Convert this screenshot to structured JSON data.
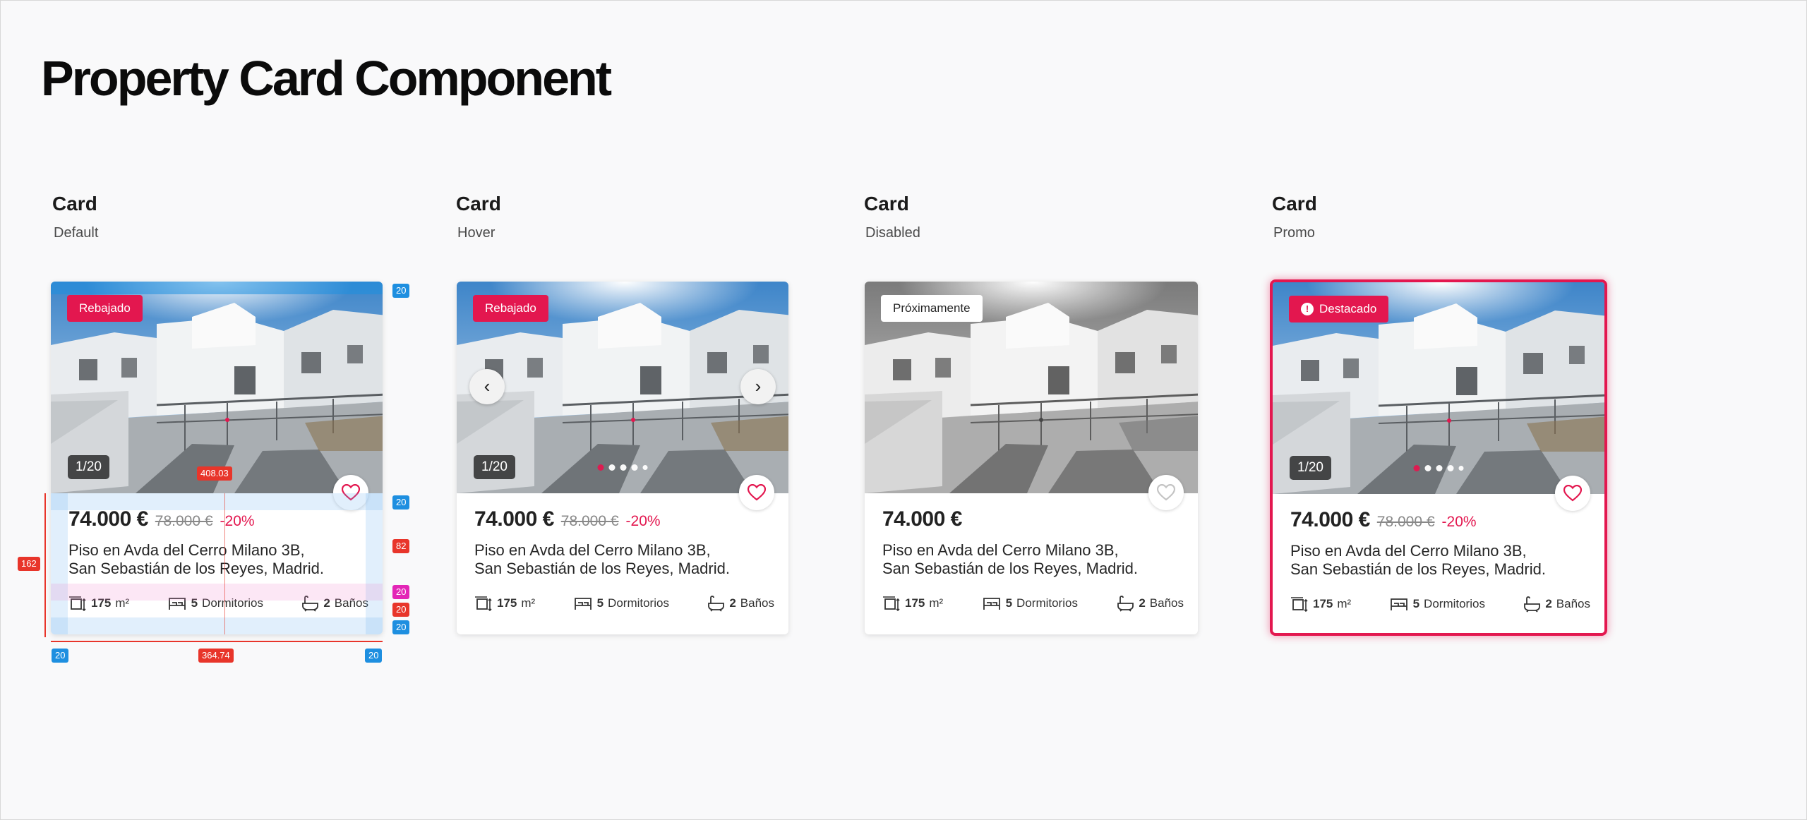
{
  "page": {
    "title": "Property Card Component"
  },
  "colors": {
    "accent": "#e3174f",
    "spec_blue": "#1e8fe0",
    "spec_red": "#e8352a",
    "spec_magenta": "#e326b6"
  },
  "shared": {
    "price": "74.000 €",
    "old_price": "78.000 €",
    "discount": "-20%",
    "address_line1": "Piso en Avda del Cerro Milano 3B,",
    "address_line2": "San Sebastián de los Reyes, Madrid.",
    "area_value": "175",
    "area_unit": "m²",
    "rooms_value": "5",
    "rooms_label": "Dormitorios",
    "baths_value": "2",
    "baths_label": "Baños",
    "counter": "1/20",
    "icons": {
      "area": "area-measure-icon",
      "bed": "bed-icon",
      "bath": "bathtub-icon",
      "fav": "heart-icon",
      "prev": "chevron-left-icon",
      "next": "chevron-right-icon",
      "alert": "alert-circle-icon"
    }
  },
  "cards": [
    {
      "name": "Card",
      "state": "Default",
      "badge": "Rebajado"
    },
    {
      "name": "Card",
      "state": "Hover",
      "badge": "Rebajado"
    },
    {
      "name": "Card",
      "state": "Disabled",
      "badge": "Próximamente"
    },
    {
      "name": "Card",
      "state": "Promo",
      "badge": "Destacado"
    }
  ],
  "spec": {
    "width": "364.74",
    "photo_offset": "408.03",
    "body_height": "162",
    "text_block": "82",
    "padding": "20",
    "feature_padding": "20"
  }
}
